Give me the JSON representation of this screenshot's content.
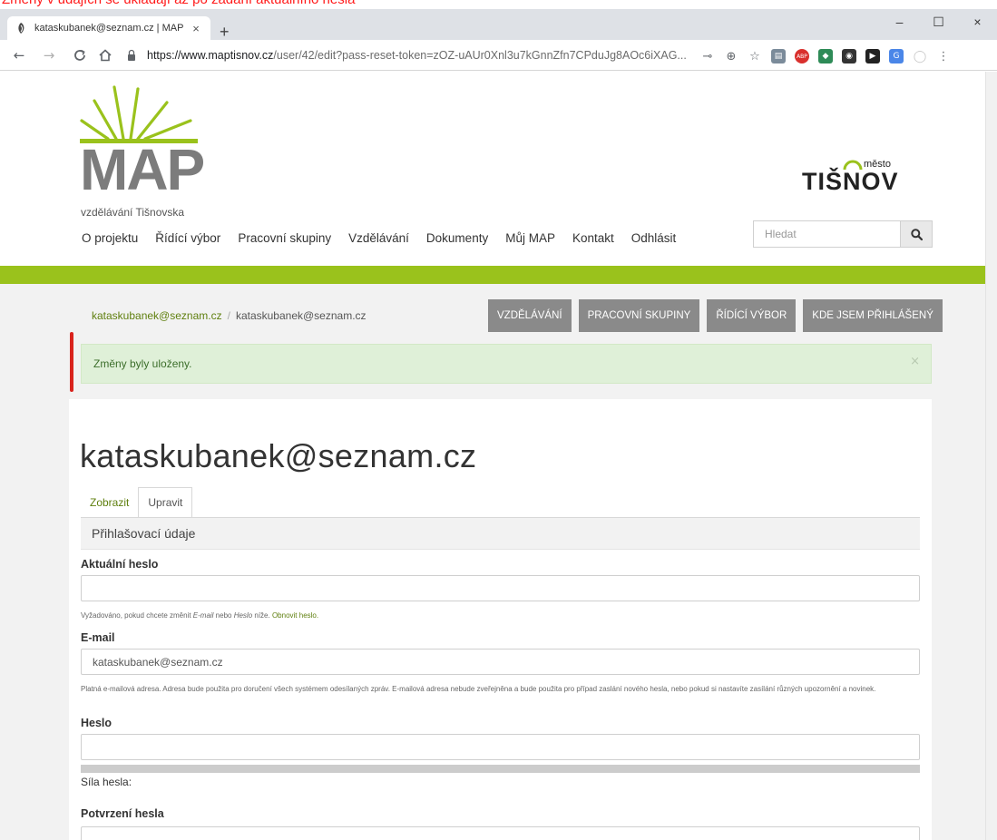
{
  "annotation": {
    "text": "Změny v údajích se ukládají až po zadání aktuálního hesla"
  },
  "browser": {
    "tab_title": "kataskubanek@seznam.cz | MAP",
    "tab_close": "×",
    "new_tab": "+",
    "url_host": "https://www.maptisnov.cz",
    "url_rest": "/user/42/edit?pass-reset-token=zOZ-uAUr0Xnl3u7kGnnZfn7CPduJg8AOc6iXAG...",
    "window_buttons": [
      "–",
      "☐",
      "×"
    ],
    "extensions": [
      {
        "name": "key-icon",
        "color": "#5f6368",
        "glyph": "⊸"
      },
      {
        "name": "zoom-icon",
        "color": "#5f6368",
        "glyph": "⊕"
      },
      {
        "name": "star-icon",
        "color": "#5f6368",
        "glyph": "☆"
      },
      {
        "name": "extension-1-icon",
        "color": "#7b8b9a",
        "glyph": "▤"
      },
      {
        "name": "adblock-icon",
        "color": "#d9302d",
        "glyph": "ABP"
      },
      {
        "name": "extension-3-icon",
        "color": "#2e8b57",
        "glyph": "◆"
      },
      {
        "name": "extension-4-icon",
        "color": "#333333",
        "glyph": "◉"
      },
      {
        "name": "extension-5-icon",
        "color": "#222222",
        "glyph": "▶"
      },
      {
        "name": "translate-icon",
        "color": "#4a86e8",
        "glyph": "G"
      },
      {
        "name": "profile-icon",
        "color": "#c8c8c8",
        "glyph": "◯"
      },
      {
        "name": "menu-icon",
        "color": "#5f6368",
        "glyph": "⋮"
      }
    ]
  },
  "site": {
    "logo_text": "MAP",
    "logo_subtitle": "vzdělávání Tišnovska",
    "town_logo_word": "TIŠNOV",
    "town_logo_prefix": "město",
    "nav": [
      "O projektu",
      "Řídící výbor",
      "Pracovní skupiny",
      "Vzdělávání",
      "Dokumenty",
      "Můj MAP",
      "Kontakt",
      "Odhlásit"
    ],
    "search_placeholder": "Hledat",
    "accent": "#9ac21c"
  },
  "breadcrumb": {
    "first": "kataskubanek@seznam.cz",
    "separator": "/",
    "current": "kataskubanek@seznam.cz"
  },
  "quick_buttons": [
    "VZDĚLÁVÁNÍ",
    "PRACOVNÍ SKUPINY",
    "ŘÍDÍCÍ VÝBOR",
    "KDE JSEM PŘIHLÁŠENÝ"
  ],
  "alert": {
    "message": "Změny byly uloženy.",
    "close": "×"
  },
  "page": {
    "title": "kataskubanek@seznam.cz",
    "tabs": [
      "Zobrazit",
      "Upravit"
    ],
    "section_title": "Přihlašovací údaje",
    "current_password": {
      "label": "Aktuální heslo",
      "value": "",
      "desc_before": "Vyžadováno, pokud chcete změnit ",
      "desc_email": "E-mail",
      "desc_mid": " nebo ",
      "desc_password": "Heslo",
      "desc_after": " níže. ",
      "desc_link": "Obnovit heslo."
    },
    "email": {
      "label": "E-mail",
      "value": "kataskubanek@seznam.cz",
      "desc": "Platná e-mailová adresa. Adresa bude použita pro doručení všech systémem odesílaných zpráv. E-mailová adresa nebude zveřejněna a bude použita pro případ zaslání nového hesla, nebo pokud si nastavíte zasílání různých upozornění a novinek."
    },
    "password": {
      "label": "Heslo",
      "value": "",
      "strength_label": "Síla hesla:"
    },
    "confirm_password": {
      "label": "Potvrzení hesla",
      "value": ""
    }
  }
}
